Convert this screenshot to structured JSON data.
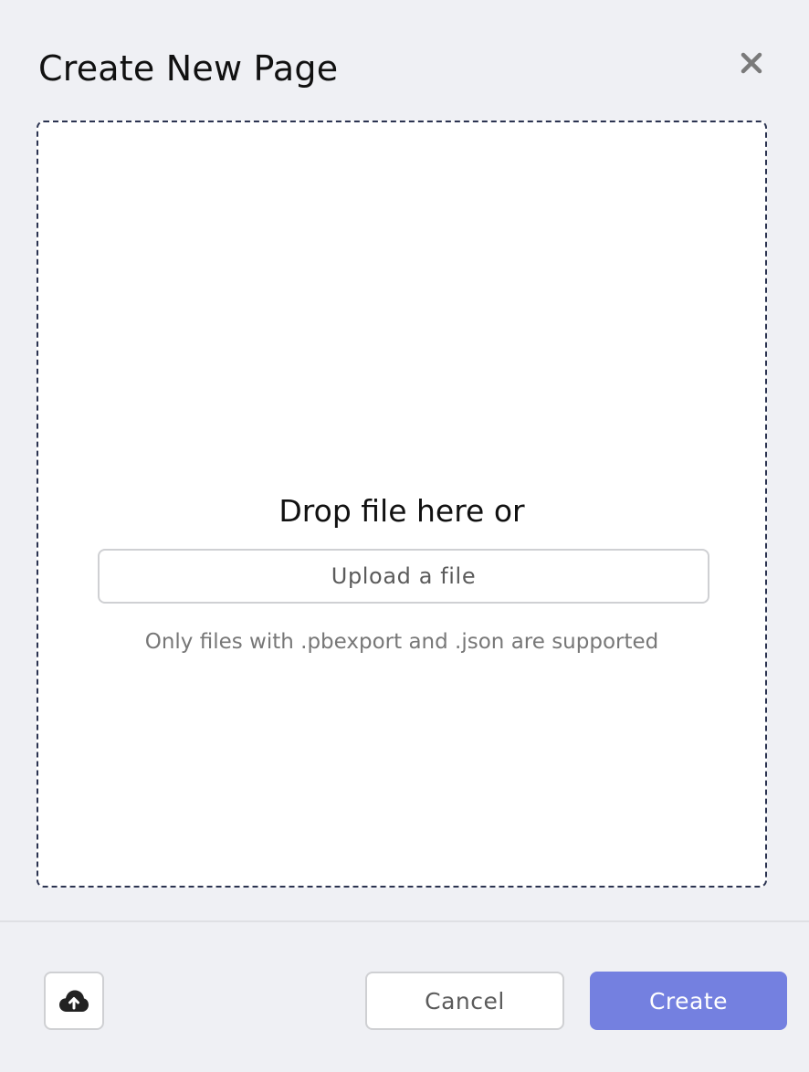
{
  "dialog": {
    "title": "Create New Page",
    "close_icon": "close-icon"
  },
  "dropzone": {
    "prompt": "Drop file here or",
    "upload_label": "Upload a file",
    "hint": "Only files with .pbexport and .json are supported"
  },
  "footer": {
    "upload_icon": "cloud-upload-icon",
    "cancel_label": "Cancel",
    "create_label": "Create"
  },
  "colors": {
    "background": "#eff0f4",
    "dropzone_border": "#2b3350",
    "primary": "#7480e0",
    "button_border": "#cfd0d3"
  }
}
